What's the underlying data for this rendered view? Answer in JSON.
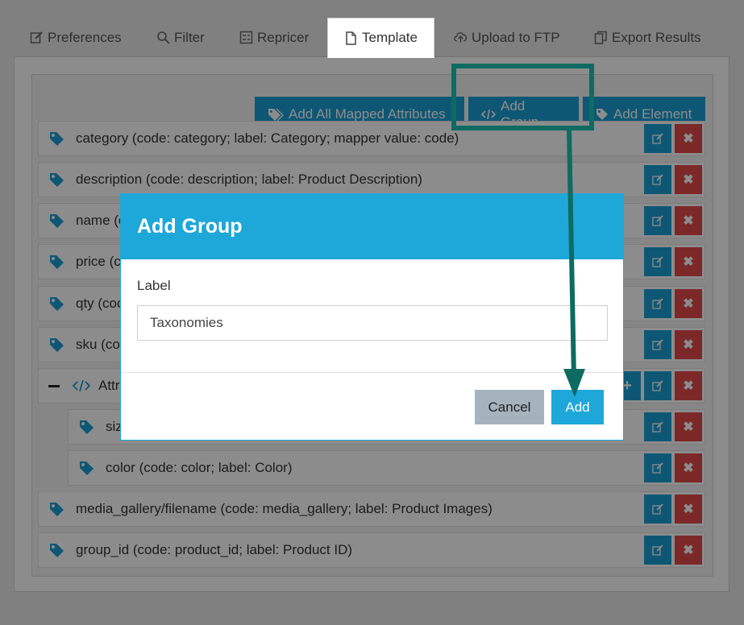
{
  "tabs": [
    {
      "label": "Preferences",
      "icon": "edit-icon"
    },
    {
      "label": "Filter",
      "icon": "search-icon"
    },
    {
      "label": "Repricer",
      "icon": "calculator-icon"
    },
    {
      "label": "Template",
      "icon": "file-icon"
    },
    {
      "label": "Upload to FTP",
      "icon": "cloud-upload-icon"
    },
    {
      "label": "Export Results",
      "icon": "copy-icon"
    }
  ],
  "toolbar": {
    "add_all_label": "Add All Mapped Attributes",
    "add_group_label": "Add Group",
    "add_element_label": "Add Element"
  },
  "rows": [
    {
      "text": "category (code: category; label: Category; mapper value: code)"
    },
    {
      "text": "description (code: description; label: Product Description)"
    },
    {
      "text": "name (c"
    },
    {
      "text": "price (c"
    },
    {
      "text": "qty (coc"
    },
    {
      "text": "sku (co"
    },
    {
      "text": "Attr"
    },
    {
      "text": "siz"
    },
    {
      "text": "color (code: color; label: Color)"
    },
    {
      "text": "media_gallery/filename (code: media_gallery; label: Product Images)"
    },
    {
      "text": "group_id (code: product_id; label: Product ID)"
    }
  ],
  "modal": {
    "title": "Add Group",
    "field_label": "Label",
    "field_value": "Taxonomies",
    "cancel_label": "Cancel",
    "ok_label": "Add"
  },
  "colors": {
    "primary": "#1a9fd4",
    "danger": "#e2494b",
    "annotation": "#0d6b62"
  }
}
